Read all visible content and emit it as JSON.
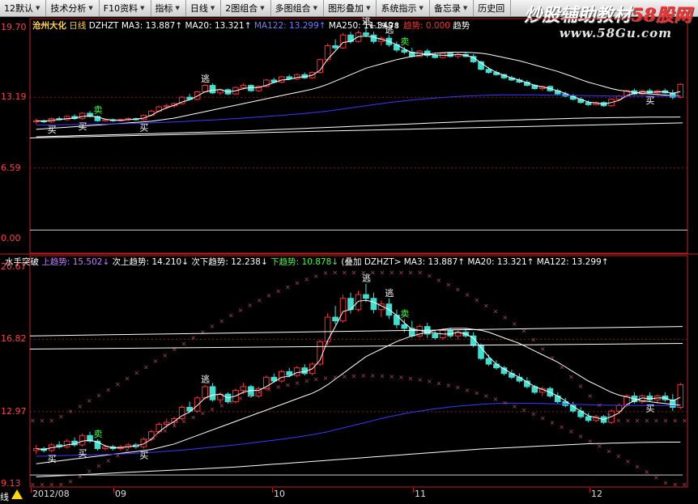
{
  "toolbar": {
    "items": [
      {
        "label": "12默认",
        "dropdown": true
      },
      {
        "label": "技术分析",
        "dropdown": true
      },
      {
        "label": "F10资料",
        "dropdown": true
      },
      {
        "label": "指标",
        "dropdown": true
      },
      {
        "label": "日线",
        "dropdown": true
      },
      {
        "label": "2图组合",
        "dropdown": true
      },
      {
        "label": "多图组合",
        "dropdown": true
      },
      {
        "label": "图形叠加",
        "dropdown": true
      },
      {
        "label": "系统指示",
        "dropdown": true
      },
      {
        "label": "备忘录",
        "dropdown": true
      },
      {
        "label": "历史回",
        "dropdown": false
      }
    ]
  },
  "watermark": {
    "pre": "炒股辅助教材",
    "hl": "58股网",
    "url": "www.58Gu.com"
  },
  "top_panel": {
    "stock": "沧州大化",
    "period": "日线",
    "indicator": "DZHZT",
    "ma_items": [
      {
        "text": "MA3: 13.887↑",
        "color": "#ffffff"
      },
      {
        "text": "MA20: 13.321↑",
        "color": "#ffffff"
      },
      {
        "text": "MA122: 13.299↑",
        "color": "#6f7cff"
      },
      {
        "text": "MA250: 11.349↑",
        "color": "#ffffff"
      },
      {
        "text": "趋势: 0.000",
        "color": "#ff3030"
      },
      {
        "text": "趋势",
        "color": "#ffffff"
      }
    ],
    "y_ticks": [
      "19.70",
      "13.19",
      "6.59",
      "0.00"
    ],
    "peak_label": "19.78",
    "signals": {
      "buy": "买",
      "escape": "逃",
      "sell": "卖"
    }
  },
  "bottom_panel": {
    "indicator_name": "水手突破",
    "items": [
      {
        "text": "上趋势: 15.502↓",
        "color": "#c080ff"
      },
      {
        "text": "次上趋势: 14.210↓",
        "color": "#ffffff"
      },
      {
        "text": "次下趋势: 12.238↓",
        "color": "#ffffff"
      },
      {
        "text": "下趋势: 10.878↓",
        "color": "#40ff40"
      },
      {
        "text": "(叠加 DZHZT> MA3: 13.887↑",
        "color": "#ffffff"
      },
      {
        "text": "MA20: 13.321↑",
        "color": "#ffffff"
      },
      {
        "text": "MA122: 13.299↑",
        "color": "#ffffff"
      }
    ],
    "y_ticks": [
      "20.67",
      "16.82",
      "12.97",
      "9.13"
    ]
  },
  "x_axis": {
    "labels": [
      "2012/08",
      "09",
      "10",
      "11",
      "12"
    ],
    "tab_label": "线"
  },
  "colors": {
    "up": "#ff3030",
    "down": "#40e0d0",
    "ma3": "#ffffff",
    "ma122": "#3a3aff",
    "dots": "#a84a6a"
  },
  "chart_data": {
    "type": "candlestick",
    "title": "沧州大化 日线",
    "dates_range": [
      "2012/08",
      "2012/12"
    ],
    "price_range_top": [
      0.0,
      19.7
    ],
    "price_range_bottom": [
      9.13,
      20.67
    ],
    "candles": [
      [
        10.9,
        11.2,
        10.7,
        11.0
      ],
      [
        11.0,
        11.1,
        10.8,
        10.9
      ],
      [
        10.9,
        11.3,
        10.8,
        11.2
      ],
      [
        11.2,
        11.4,
        11.0,
        11.1
      ],
      [
        11.1,
        11.5,
        11.0,
        11.4
      ],
      [
        11.4,
        11.6,
        11.1,
        11.2
      ],
      [
        11.2,
        11.8,
        11.1,
        11.7
      ],
      [
        11.7,
        11.9,
        11.3,
        11.4
      ],
      [
        11.4,
        11.5,
        10.9,
        11.0
      ],
      [
        11.0,
        11.2,
        10.9,
        11.1
      ],
      [
        11.1,
        11.2,
        10.9,
        11.0
      ],
      [
        11.0,
        11.2,
        10.9,
        11.1
      ],
      [
        11.1,
        11.3,
        11.0,
        11.2
      ],
      [
        11.2,
        11.3,
        11.0,
        11.1
      ],
      [
        11.1,
        11.6,
        11.0,
        11.5
      ],
      [
        11.5,
        12.0,
        11.4,
        11.9
      ],
      [
        11.9,
        12.4,
        11.8,
        12.3
      ],
      [
        12.3,
        12.6,
        12.1,
        12.4
      ],
      [
        12.4,
        12.7,
        12.2,
        12.6
      ],
      [
        12.6,
        13.3,
        12.5,
        13.2
      ],
      [
        13.2,
        13.5,
        12.9,
        13.0
      ],
      [
        13.0,
        13.8,
        12.9,
        13.7
      ],
      [
        13.7,
        14.4,
        13.6,
        14.3
      ],
      [
        14.3,
        14.5,
        13.5,
        13.6
      ],
      [
        13.6,
        14.0,
        13.4,
        13.9
      ],
      [
        13.9,
        14.0,
        13.4,
        13.5
      ],
      [
        13.5,
        14.2,
        13.4,
        14.1
      ],
      [
        14.1,
        14.5,
        13.9,
        14.3
      ],
      [
        14.3,
        14.4,
        13.7,
        13.8
      ],
      [
        13.8,
        14.3,
        13.7,
        14.2
      ],
      [
        14.2,
        14.9,
        14.1,
        14.8
      ],
      [
        14.8,
        15.0,
        14.5,
        14.6
      ],
      [
        14.6,
        15.2,
        14.5,
        15.1
      ],
      [
        15.1,
        15.3,
        14.8,
        14.9
      ],
      [
        14.9,
        15.4,
        14.8,
        15.3
      ],
      [
        15.3,
        15.5,
        14.9,
        15.0
      ],
      [
        15.0,
        15.6,
        14.9,
        15.5
      ],
      [
        15.5,
        16.8,
        15.4,
        16.7
      ],
      [
        16.7,
        18.2,
        16.5,
        18.0
      ],
      [
        18.0,
        18.6,
        17.6,
        17.8
      ],
      [
        17.8,
        19.2,
        17.7,
        19.0
      ],
      [
        19.0,
        19.3,
        18.2,
        18.4
      ],
      [
        18.4,
        19.4,
        18.3,
        19.2
      ],
      [
        19.2,
        19.78,
        18.8,
        19.0
      ],
      [
        19.0,
        19.3,
        18.2,
        18.4
      ],
      [
        18.4,
        18.9,
        18.0,
        18.7
      ],
      [
        18.7,
        19.0,
        17.9,
        18.1
      ],
      [
        18.1,
        18.4,
        17.4,
        17.6
      ],
      [
        17.6,
        17.9,
        17.2,
        17.4
      ],
      [
        17.4,
        17.8,
        16.9,
        17.0
      ],
      [
        17.0,
        17.6,
        16.9,
        17.5
      ],
      [
        17.5,
        17.7,
        16.9,
        17.1
      ],
      [
        17.1,
        17.3,
        16.8,
        16.9
      ],
      [
        16.9,
        17.4,
        16.8,
        17.3
      ],
      [
        17.3,
        17.4,
        16.9,
        17.0
      ],
      [
        17.0,
        17.3,
        16.8,
        17.2
      ],
      [
        17.2,
        17.4,
        16.9,
        17.0
      ],
      [
        17.0,
        17.2,
        16.4,
        16.5
      ],
      [
        16.5,
        16.6,
        15.7,
        15.8
      ],
      [
        15.8,
        16.0,
        15.4,
        15.5
      ],
      [
        15.5,
        15.7,
        15.2,
        15.3
      ],
      [
        15.3,
        15.4,
        14.9,
        15.0
      ],
      [
        15.0,
        15.2,
        14.7,
        14.8
      ],
      [
        14.8,
        15.0,
        14.5,
        14.6
      ],
      [
        14.6,
        14.8,
        14.2,
        14.3
      ],
      [
        14.3,
        14.4,
        13.9,
        14.0
      ],
      [
        14.0,
        14.3,
        13.8,
        14.2
      ],
      [
        14.2,
        14.3,
        13.7,
        13.8
      ],
      [
        13.8,
        14.0,
        13.4,
        13.5
      ],
      [
        13.5,
        13.7,
        13.2,
        13.3
      ],
      [
        13.3,
        13.5,
        12.9,
        13.0
      ],
      [
        13.0,
        13.2,
        12.6,
        12.7
      ],
      [
        12.7,
        12.9,
        12.4,
        12.5
      ],
      [
        12.5,
        12.8,
        12.4,
        12.7
      ],
      [
        12.7,
        12.8,
        12.3,
        12.4
      ],
      [
        12.4,
        13.1,
        12.3,
        13.0
      ],
      [
        13.0,
        13.4,
        12.9,
        13.3
      ],
      [
        13.3,
        13.9,
        13.2,
        13.8
      ],
      [
        13.8,
        14.0,
        13.4,
        13.5
      ],
      [
        13.5,
        13.9,
        13.4,
        13.8
      ],
      [
        13.8,
        14.0,
        13.5,
        13.6
      ],
      [
        13.6,
        13.9,
        13.4,
        13.8
      ],
      [
        13.8,
        14.0,
        13.5,
        13.6
      ],
      [
        13.6,
        13.9,
        13.0,
        13.2
      ],
      [
        13.2,
        14.5,
        13.1,
        14.4
      ]
    ],
    "series": [
      {
        "name": "MA3",
        "values": [
          11.0,
          10.95,
          11.05,
          11.1,
          11.2,
          11.25,
          11.4,
          11.45,
          11.35,
          11.15,
          11.05,
          11.05,
          11.1,
          11.15,
          11.25,
          11.5,
          11.9,
          12.2,
          12.45,
          12.75,
          12.95,
          13.3,
          13.7,
          13.85,
          13.9,
          13.7,
          13.8,
          14.0,
          14.1,
          14.1,
          14.3,
          14.55,
          14.8,
          14.85,
          15.05,
          15.1,
          15.25,
          15.7,
          16.75,
          17.5,
          18.3,
          18.4,
          18.85,
          18.9,
          18.8,
          18.6,
          18.4,
          18.1,
          17.7,
          17.35,
          17.3,
          17.2,
          17.15,
          17.1,
          17.1,
          17.2,
          17.1,
          16.9,
          16.4,
          15.9,
          15.5,
          15.25,
          15.0,
          14.8,
          14.55,
          14.3,
          14.15,
          14.0,
          13.8,
          13.55,
          13.25,
          13.0,
          12.75,
          12.65,
          12.55,
          12.7,
          12.9,
          13.35,
          13.55,
          13.7,
          13.65,
          13.7,
          13.7,
          13.55,
          13.73
        ]
      },
      {
        "name": "MA20",
        "values": [
          10.2,
          10.25,
          10.3,
          10.35,
          10.4,
          10.45,
          10.5,
          10.55,
          10.6,
          10.65,
          10.7,
          10.75,
          10.8,
          10.85,
          10.9,
          10.95,
          11.05,
          11.15,
          11.25,
          11.4,
          11.55,
          11.7,
          11.85,
          12.0,
          12.15,
          12.3,
          12.45,
          12.6,
          12.75,
          12.9,
          13.05,
          13.2,
          13.35,
          13.5,
          13.65,
          13.8,
          13.95,
          14.15,
          14.4,
          14.7,
          15.0,
          15.3,
          15.6,
          15.9,
          16.1,
          16.3,
          16.5,
          16.7,
          16.85,
          17.0,
          17.1,
          17.2,
          17.3,
          17.35,
          17.4,
          17.4,
          17.4,
          17.35,
          17.3,
          17.2,
          17.05,
          16.9,
          16.75,
          16.6,
          16.4,
          16.2,
          16.0,
          15.8,
          15.6,
          15.35,
          15.1,
          14.85,
          14.6,
          14.4,
          14.2,
          14.0,
          13.85,
          13.75,
          13.65,
          13.55,
          13.5,
          13.45,
          13.4,
          13.35,
          13.32
        ]
      },
      {
        "name": "MA122",
        "values": [
          10.6,
          10.6,
          10.62,
          10.63,
          10.64,
          10.65,
          10.66,
          10.67,
          10.68,
          10.69,
          10.7,
          10.72,
          10.74,
          10.76,
          10.78,
          10.8,
          10.83,
          10.86,
          10.89,
          10.92,
          10.96,
          11.0,
          11.04,
          11.08,
          11.12,
          11.16,
          11.2,
          11.25,
          11.3,
          11.35,
          11.4,
          11.45,
          11.5,
          11.56,
          11.62,
          11.68,
          11.75,
          11.82,
          11.9,
          12.0,
          12.1,
          12.2,
          12.3,
          12.4,
          12.5,
          12.6,
          12.7,
          12.78,
          12.86,
          12.94,
          13.0,
          13.06,
          13.12,
          13.17,
          13.22,
          13.26,
          13.3,
          13.33,
          13.36,
          13.38,
          13.4,
          13.41,
          13.42,
          13.42,
          13.42,
          13.41,
          13.4,
          13.39,
          13.38,
          13.37,
          13.36,
          13.35,
          13.34,
          13.33,
          13.32,
          13.31,
          13.31,
          13.3,
          13.3,
          13.3,
          13.3,
          13.3,
          13.3,
          13.3,
          13.3
        ]
      },
      {
        "name": "MA250",
        "values": [
          9.5,
          9.52,
          9.54,
          9.56,
          9.58,
          9.6,
          9.62,
          9.64,
          9.66,
          9.68,
          9.7,
          9.72,
          9.74,
          9.76,
          9.78,
          9.8,
          9.82,
          9.84,
          9.86,
          9.88,
          9.9,
          9.92,
          9.94,
          9.96,
          9.98,
          10.0,
          10.02,
          10.05,
          10.08,
          10.11,
          10.14,
          10.17,
          10.2,
          10.23,
          10.26,
          10.29,
          10.32,
          10.35,
          10.38,
          10.41,
          10.44,
          10.47,
          10.5,
          10.53,
          10.56,
          10.59,
          10.62,
          10.65,
          10.68,
          10.71,
          10.74,
          10.77,
          10.8,
          10.83,
          10.86,
          10.89,
          10.92,
          10.95,
          10.98,
          11.0,
          11.02,
          11.04,
          11.06,
          11.08,
          11.1,
          11.12,
          11.14,
          11.16,
          11.18,
          11.2,
          11.22,
          11.24,
          11.26,
          11.27,
          11.28,
          11.29,
          11.3,
          11.31,
          11.32,
          11.33,
          11.34,
          11.345,
          11.347,
          11.348,
          11.349
        ]
      }
    ],
    "signals": [
      {
        "index": 2,
        "type": "buy"
      },
      {
        "index": 6,
        "type": "buy"
      },
      {
        "index": 8,
        "type": "sell"
      },
      {
        "index": 14,
        "type": "buy"
      },
      {
        "index": 22,
        "type": "escape"
      },
      {
        "index": 43,
        "type": "escape"
      },
      {
        "index": 46,
        "type": "escape"
      },
      {
        "index": 48,
        "type": "sell"
      },
      {
        "index": 80,
        "type": "buy"
      }
    ]
  }
}
